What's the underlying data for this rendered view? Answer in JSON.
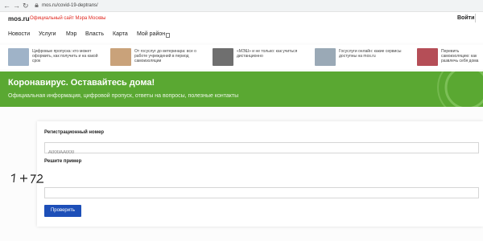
{
  "browser": {
    "back": "←",
    "forward": "→",
    "reload": "↻",
    "url": "mos.ru/covid-19-deptrans/"
  },
  "header": {
    "logo": "mos.ru",
    "subtitle": "Официальный сайт Мэра Москвы",
    "login": "Войти"
  },
  "nav": {
    "items": [
      "Новости",
      "Услуги",
      "Мэр",
      "Власть",
      "Карта",
      "Мой район"
    ]
  },
  "news": [
    {
      "text": "Цифровые пропуска: кто может оформить, как получить и на какой срок",
      "thumb_color": "#9fb3c8"
    },
    {
      "text": "От госуслуг до ветеринара: все о работе учреждений в период самоизоляции",
      "thumb_color": "#c9a27a"
    },
    {
      "text": "«МЭШ» и не только: как учиться дистанционно",
      "thumb_color": "#6f6f6f"
    },
    {
      "text": "Госуслуги онлайн: какие сервисы доступны на mos.ru",
      "thumb_color": "#9aa9b6"
    },
    {
      "text": "Перевить самоизоляцию: как развлечь себя дома",
      "thumb_color": "#b54e57"
    }
  ],
  "banner": {
    "title": "Коронавирус. Оставайтесь дома!",
    "subtitle": "Официальная информация, цифровой пропуск, ответы на вопросы, полезные контакты",
    "color": "#5aa832"
  },
  "form": {
    "reg_label": "Регистрационный номер",
    "reg_placeholder": "А000АА000",
    "captcha_label": "Решите пример",
    "captcha_answer": "",
    "submit": "Проверить",
    "button_color": "#1d4fb8"
  }
}
